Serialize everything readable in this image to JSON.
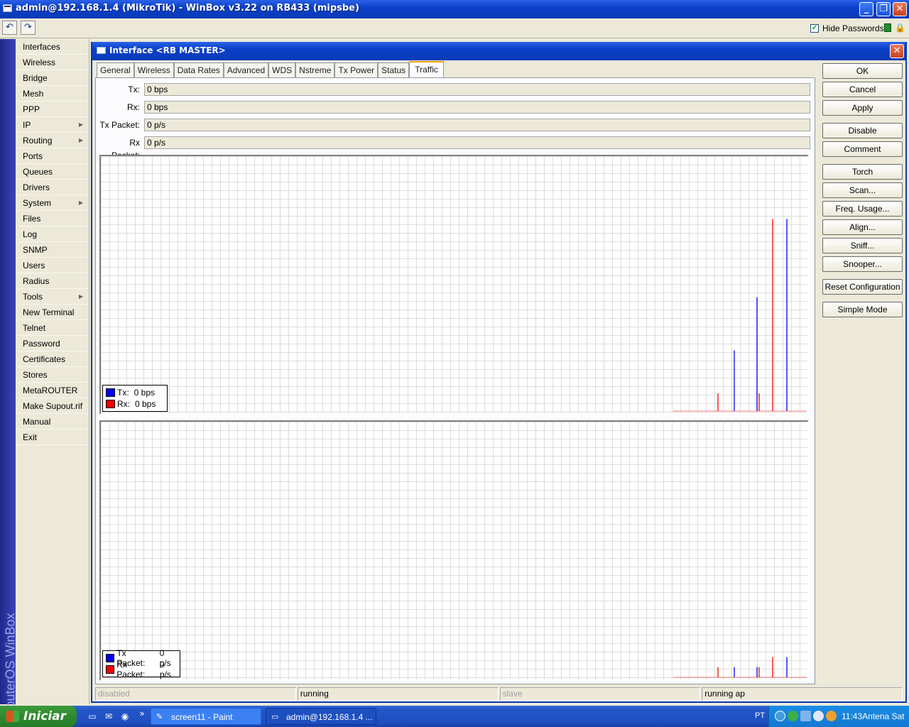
{
  "window": {
    "title": "admin@192.168.1.4 (MikroTik) - WinBox v3.22 on RB433 (mipsbe)",
    "minimize_glyph": "_",
    "restore_glyph": "❐",
    "close_glyph": "✕"
  },
  "toolbar": {
    "undo_icon": "undo-icon",
    "redo_icon": "redo-icon",
    "hide_passwords_label": "Hide Passwords",
    "hide_passwords_checked": true
  },
  "brand_text": "RouterOS WinBox",
  "menu": [
    {
      "label": "Interfaces",
      "submenu": false
    },
    {
      "label": "Wireless",
      "submenu": false
    },
    {
      "label": "Bridge",
      "submenu": false
    },
    {
      "label": "Mesh",
      "submenu": false
    },
    {
      "label": "PPP",
      "submenu": false
    },
    {
      "label": "IP",
      "submenu": true
    },
    {
      "label": "Routing",
      "submenu": true
    },
    {
      "label": "Ports",
      "submenu": false
    },
    {
      "label": "Queues",
      "submenu": false
    },
    {
      "label": "Drivers",
      "submenu": false
    },
    {
      "label": "System",
      "submenu": true
    },
    {
      "label": "Files",
      "submenu": false
    },
    {
      "label": "Log",
      "submenu": false
    },
    {
      "label": "SNMP",
      "submenu": false
    },
    {
      "label": "Users",
      "submenu": false
    },
    {
      "label": "Radius",
      "submenu": false
    },
    {
      "label": "Tools",
      "submenu": true
    },
    {
      "label": "New Terminal",
      "submenu": false
    },
    {
      "label": "Telnet",
      "submenu": false
    },
    {
      "label": "Password",
      "submenu": false
    },
    {
      "label": "Certificates",
      "submenu": false
    },
    {
      "label": "Stores",
      "submenu": false
    },
    {
      "label": "MetaROUTER",
      "submenu": false
    },
    {
      "label": "Make Supout.rif",
      "submenu": false
    },
    {
      "label": "Manual",
      "submenu": false
    },
    {
      "label": "Exit",
      "submenu": false
    }
  ],
  "dialog": {
    "title": "Interface <RB MASTER>",
    "tabs": [
      "General",
      "Wireless",
      "Data Rates",
      "Advanced",
      "WDS",
      "Nstreme",
      "Tx Power",
      "Status",
      "Traffic"
    ],
    "active_tab": "Traffic",
    "fields": [
      {
        "label": "Tx:",
        "value": "0 bps"
      },
      {
        "label": "Rx:",
        "value": "0 bps"
      },
      {
        "label": "Tx Packet:",
        "value": "0 p/s"
      },
      {
        "label": "Rx Packet:",
        "value": "0 p/s"
      }
    ],
    "buttons": [
      "OK",
      "Cancel",
      "Apply",
      "Disable",
      "Comment",
      "Torch",
      "Scan...",
      "Freq. Usage...",
      "Align...",
      "Sniff...",
      "Snooper...",
      "Reset Configuration",
      "Simple Mode"
    ],
    "status": [
      "disabled",
      "running",
      "slave",
      "running ap"
    ]
  },
  "chart_data": [
    {
      "type": "bar",
      "title": "",
      "legend": [
        {
          "label": "Tx:",
          "value": "0 bps",
          "color": "#0000ff"
        },
        {
          "label": "Rx:",
          "value": "0 bps",
          "color": "#ff0000"
        }
      ],
      "legend_placement": "bottom-left",
      "grid": true,
      "ylim": [
        0,
        1
      ],
      "series": [
        {
          "name": "Tx",
          "color": "#0000ff",
          "spikes": [
            {
              "pos": 0.896,
              "value": 0.24
            },
            {
              "pos": 0.929,
              "value": 0.45
            },
            {
              "pos": 0.971,
              "value": 0.76
            }
          ]
        },
        {
          "name": "Rx",
          "color": "#ff0000",
          "spikes": [
            {
              "pos": 0.873,
              "value": 0.07
            },
            {
              "pos": 0.932,
              "value": 0.07
            },
            {
              "pos": 0.951,
              "value": 0.76
            }
          ]
        }
      ]
    },
    {
      "type": "bar",
      "title": "",
      "legend": [
        {
          "label": "Tx Packet:",
          "value": "0 p/s",
          "color": "#0000ff"
        },
        {
          "label": "Rx Packet:",
          "value": "0 p/s",
          "color": "#ff0000"
        }
      ],
      "legend_placement": "bottom-left",
      "grid": true,
      "ylim": [
        0,
        1
      ],
      "series": [
        {
          "name": "Tx Packet",
          "color": "#0000ff",
          "spikes": [
            {
              "pos": 0.896,
              "value": 0.04
            },
            {
              "pos": 0.929,
              "value": 0.04
            },
            {
              "pos": 0.971,
              "value": 0.08
            }
          ]
        },
        {
          "name": "Rx Packet",
          "color": "#ff0000",
          "spikes": [
            {
              "pos": 0.873,
              "value": 0.04
            },
            {
              "pos": 0.932,
              "value": 0.04
            },
            {
              "pos": 0.951,
              "value": 0.08
            }
          ]
        }
      ]
    }
  ],
  "taskbar": {
    "start_label": "Iniciar",
    "overflow_glyph": "»",
    "tasks": [
      {
        "label": "screen11 - Paint",
        "icon": "paint-icon"
      },
      {
        "label": "admin@192.168.1.4 ...",
        "icon": "winbox-icon"
      }
    ],
    "language": "PT",
    "clock": "11:43Antena Sat"
  }
}
